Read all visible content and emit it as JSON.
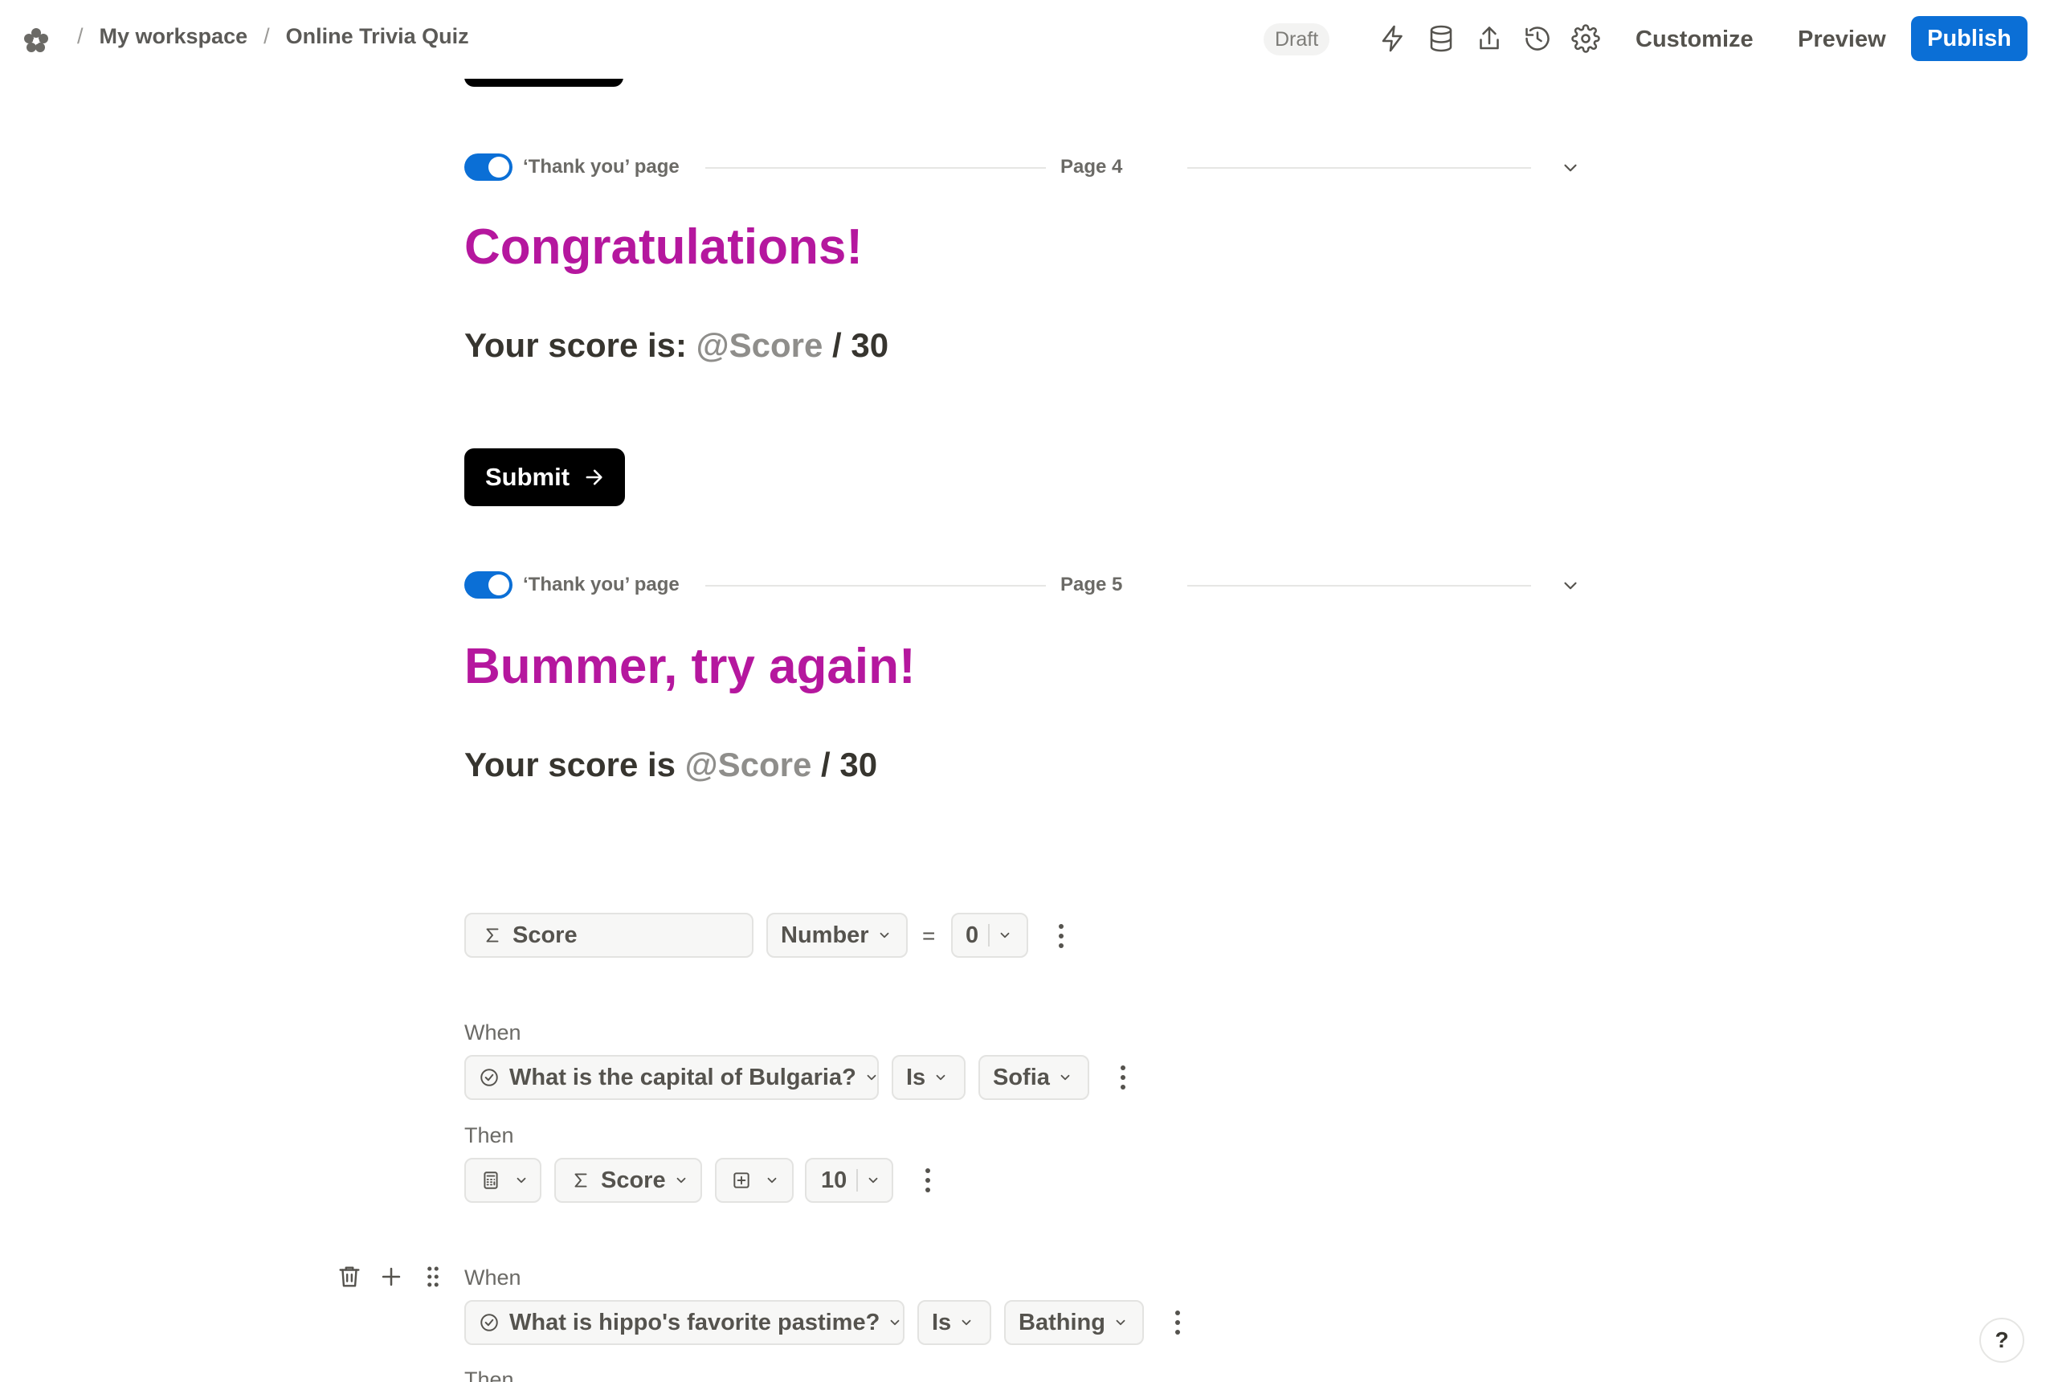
{
  "breadcrumb": {
    "separator": "/",
    "workspace": "My workspace",
    "form": "Online Trivia Quiz"
  },
  "header": {
    "status_badge": "Draft",
    "icons": [
      "lightning-icon",
      "database-icon",
      "share-icon",
      "history-icon",
      "gear-icon"
    ],
    "customize_label": "Customize",
    "preview_label": "Preview",
    "publish_label": "Publish",
    "accent_color": "#0b6fd6"
  },
  "pages": [
    {
      "toggle_on": true,
      "type_label": "‘Thank you’ page",
      "page_label": "Page 4",
      "title": "Congratulations!",
      "score_prefix": "Your score is:",
      "score_mention": "@Score",
      "score_suffix": "/ 30",
      "button_label": "Submit"
    },
    {
      "toggle_on": true,
      "type_label": "‘Thank you’ page",
      "page_label": "Page 5",
      "title": "Bummer, try again!",
      "score_prefix": "Your score is",
      "score_mention": "@Score",
      "score_suffix": "/ 30"
    }
  ],
  "title_color": "#b5179e",
  "calculation": {
    "variable_name": "Score",
    "type": "Number",
    "operator": "=",
    "initial_value": "0"
  },
  "rules": [
    {
      "when_label": "When",
      "question": "What is the capital of Bulgaria?",
      "comparator": "Is",
      "answer": "Sofia",
      "then_label": "Then",
      "target": "Score",
      "amount": "10"
    },
    {
      "when_label": "When",
      "question": "What is hippo's favorite pastime?",
      "comparator": "Is",
      "answer": "Bathing",
      "then_label": "Then"
    }
  ],
  "help_label": "?"
}
